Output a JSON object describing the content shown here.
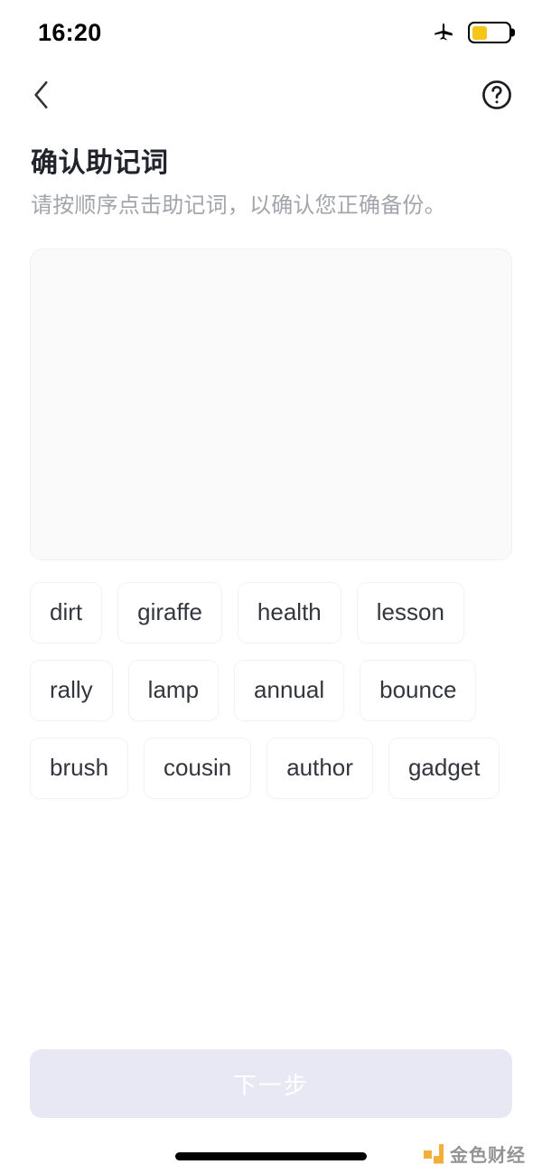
{
  "status_bar": {
    "time": "16:20",
    "airplane_icon": "airplane-mode-icon",
    "battery_icon": "battery-low-power-icon",
    "battery_level_percent": 42,
    "battery_color": "#f5c518"
  },
  "nav": {
    "back_icon": "chevron-left-icon",
    "help_icon": "question-mark-circle-icon"
  },
  "header": {
    "title": "确认助记词",
    "subtitle": "请按顺序点击助记词，以确认您正确备份。"
  },
  "answer_area": {
    "selected_words": [],
    "background": "#fafafa"
  },
  "word_bank": {
    "words": [
      "dirt",
      "giraffe",
      "health",
      "lesson",
      "rally",
      "lamp",
      "annual",
      "bounce",
      "brush",
      "cousin",
      "author",
      "gadget"
    ]
  },
  "footer": {
    "next_label": "下一步",
    "next_enabled": false,
    "next_background": "#e8e7f4"
  },
  "watermark": {
    "text": "金色财经",
    "mark_color": "#f0a82a"
  }
}
